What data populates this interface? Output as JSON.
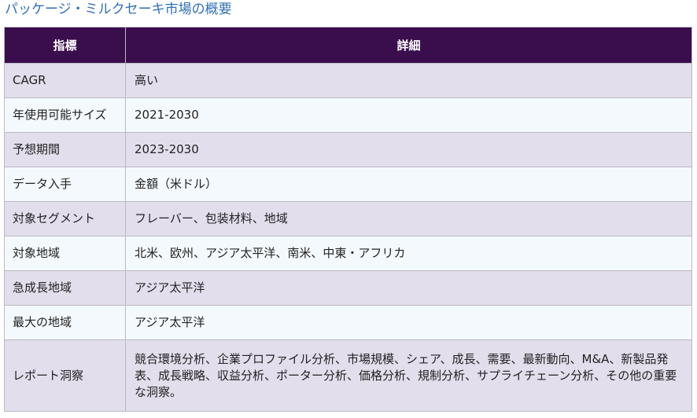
{
  "title": "パッケージ・ミルクセーキ市場の概要",
  "table": {
    "headers": [
      "指標",
      "詳細"
    ],
    "rows": [
      {
        "metric": "CAGR",
        "detail": "高い"
      },
      {
        "metric": "年使用可能サイズ",
        "detail": "2021-2030"
      },
      {
        "metric": "予想期間",
        "detail": "2023-2030"
      },
      {
        "metric": "データ入手",
        "detail": "金額（米ドル）"
      },
      {
        "metric": "対象セグメント",
        "detail": "フレーバー、包装材料、地域"
      },
      {
        "metric": "対象地域",
        "detail": "北米、欧州、アジア太平洋、南米、中東・アフリカ"
      },
      {
        "metric": "急成長地域",
        "detail": "アジア太平洋"
      },
      {
        "metric": "最大の地域",
        "detail": "アジア太平洋"
      },
      {
        "metric": "レポート洞察",
        "detail": "競合環境分析、企業プロファイル分析、市場規模、シェア、成長、需要、最新動向、M&A、新製品発表、成長戦略、収益分析、ポーター分析、価格分析、規制分析、サプライチェーン分析、その他の重要な洞察。"
      }
    ]
  },
  "colors": {
    "title": "#2f6fb6",
    "header_bg": "#3a0e4c",
    "row_odd_bg": "#e2deec",
    "row_even_bg": "#f4f9fd",
    "border": "#bdb8c6"
  }
}
